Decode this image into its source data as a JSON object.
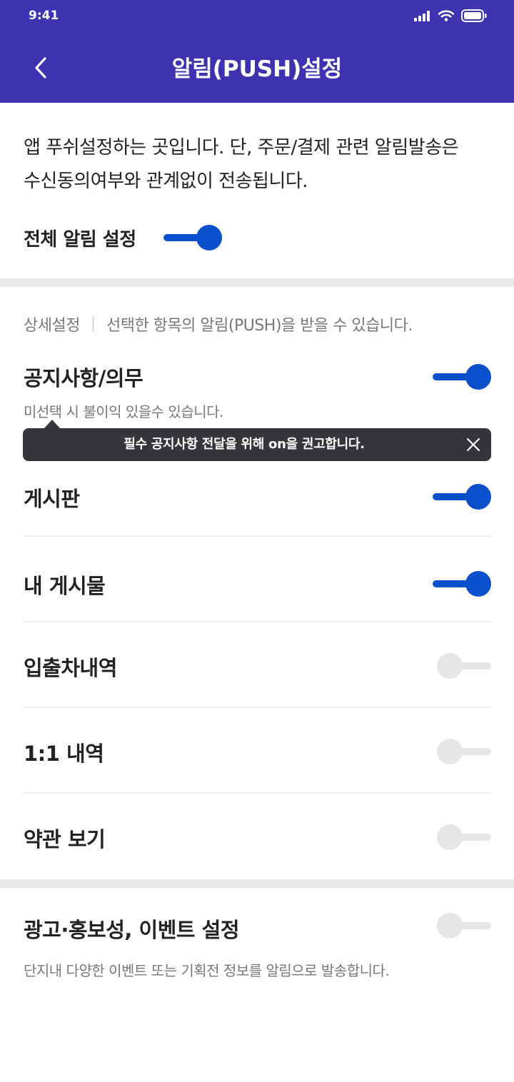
{
  "status_bar": {
    "time": "9:41"
  },
  "header": {
    "title": "알림(PUSH)설정"
  },
  "intro": {
    "line1": "앱 푸쉬설정하는 곳입니다. 단, 주문/결제 관련 알림발송은",
    "line2": "수신동의여부와 관계없이 전송됩니다.",
    "all_label": "전체 알림 설정",
    "all_on": true
  },
  "detail": {
    "heading": "상세설정",
    "description": "선택한 항목의 알림(PUSH)을 받을 수 있습니다.",
    "items": [
      {
        "label": "공지사항/의무",
        "sub": "미선택 시 불이익 있을수 있습니다.",
        "on": true
      },
      {
        "label": "게시판",
        "on": true
      },
      {
        "label": "내 게시물",
        "on": true
      },
      {
        "label": "입출차내역",
        "on": false
      },
      {
        "label": "1:1 내역",
        "on": false
      },
      {
        "label": "약관 보기",
        "on": false
      }
    ]
  },
  "tooltip": {
    "text": "필수 공지사항 전달을 위해 on을 권고합니다."
  },
  "marketing": {
    "label": "광고·홍보성, 이벤트 설정",
    "sub": "단지내 다양한 이벤트 또는 기획전 정보를 알림으로 발송합니다.",
    "on": false
  },
  "colors": {
    "header": "#3d33b0",
    "toggle_on": "#0a4fcc",
    "toggle_off": "#e6e6e6",
    "tooltip": "#35353a"
  }
}
